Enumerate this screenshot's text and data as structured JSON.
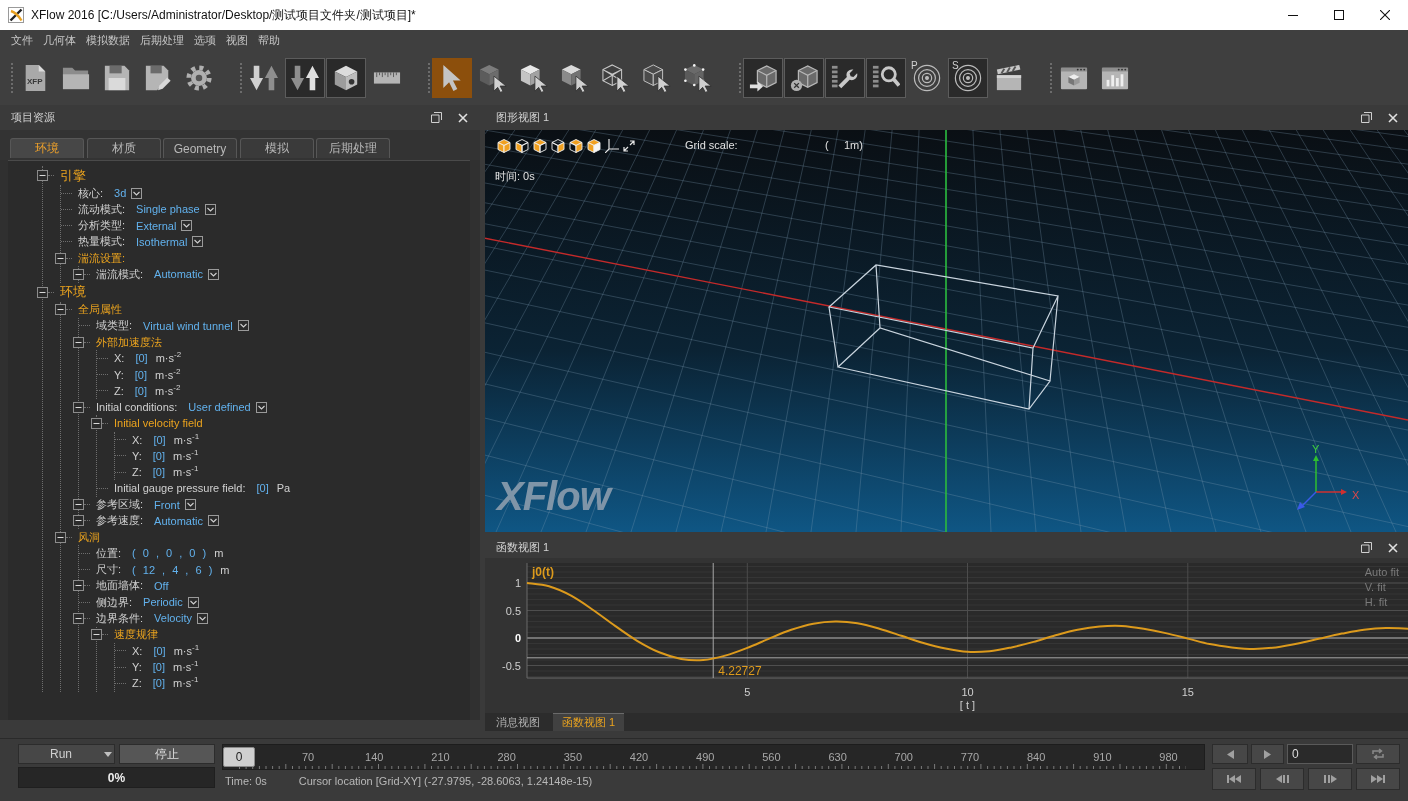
{
  "window": {
    "title": "XFlow 2016 [C:/Users/Administrator/Desktop/测试项目文件夹/测试项目]*"
  },
  "menu": [
    "文件",
    "几何体",
    "模拟数据",
    "后期处理",
    "选项",
    "视图",
    "帮助"
  ],
  "toolbar": {
    "groups": [
      [
        {
          "label": "XFP",
          "selected": false,
          "toggled": false
        },
        {
          "selected": false,
          "toggled": false
        },
        {
          "selected": false,
          "toggled": false
        },
        {
          "selected": false,
          "toggled": false
        },
        {
          "selected": false,
          "toggled": false
        }
      ],
      [
        {
          "selected": false,
          "toggled": false
        },
        {
          "selected": false,
          "toggled": true
        },
        {
          "selected": false,
          "toggled": true
        },
        {
          "selected": false,
          "toggled": false
        }
      ],
      [
        {
          "selected": true,
          "toggled": false
        },
        {
          "selected": false,
          "toggled": false
        },
        {
          "selected": false,
          "toggled": false
        },
        {
          "selected": false,
          "toggled": false
        },
        {
          "selected": false,
          "toggled": false
        },
        {
          "selected": false,
          "toggled": false
        },
        {
          "selected": false,
          "toggled": false
        }
      ],
      [
        {
          "selected": false,
          "toggled": true
        },
        {
          "selected": false,
          "toggled": true
        },
        {
          "selected": false,
          "toggled": true
        },
        {
          "selected": false,
          "toggled": true
        },
        {
          "label": "P",
          "selected": false,
          "toggled": false
        },
        {
          "label": "S",
          "selected": false,
          "toggled": true
        },
        {
          "selected": false,
          "toggled": false
        }
      ],
      [
        {
          "selected": false,
          "toggled": false
        },
        {
          "selected": false,
          "toggled": false
        }
      ]
    ]
  },
  "left_panel": {
    "title": "项目资源",
    "tabs": [
      {
        "label": "环境",
        "selected": true
      },
      {
        "label": "材质",
        "selected": false
      },
      {
        "label": "Geometry",
        "selected": false
      },
      {
        "label": "模拟",
        "selected": false
      },
      {
        "label": "后期处理",
        "selected": false
      }
    ],
    "tree": [
      {
        "kind": "group",
        "label": "引擎",
        "expanded": true,
        "children": [
          {
            "kind": "dropdown",
            "label": "核心:",
            "value": "3d"
          },
          {
            "kind": "dropdown",
            "label": "流动模式:",
            "value": "Single phase"
          },
          {
            "kind": "dropdown",
            "label": "分析类型:",
            "value": "External"
          },
          {
            "kind": "dropdown",
            "label": "热量模式:",
            "value": "Isothermal"
          },
          {
            "kind": "group",
            "label": "湍流设置:",
            "expanded": true,
            "children": [
              {
                "kind": "dropdown",
                "label": "湍流模式:",
                "value": "Automatic",
                "expanded": true
              }
            ]
          }
        ]
      },
      {
        "kind": "group",
        "label": "环境",
        "expanded": true,
        "children": [
          {
            "kind": "group",
            "label": "全局属性",
            "expanded": true,
            "children": [
              {
                "kind": "dropdown",
                "label": "域类型:",
                "value": "Virtual wind tunnel"
              },
              {
                "kind": "group",
                "label": "外部加速度法",
                "expanded": true,
                "children": [
                  {
                    "kind": "quantity",
                    "label": "X:",
                    "value": "[0]",
                    "unit": "m·s$^{-2}$"
                  },
                  {
                    "kind": "quantity",
                    "label": "Y:",
                    "value": "[0]",
                    "unit": "m·s$^{-2}$"
                  },
                  {
                    "kind": "quantity",
                    "label": "Z:",
                    "value": "[0]",
                    "unit": "m·s$^{-2}$"
                  }
                ]
              },
              {
                "kind": "dropdown",
                "label": "Initial conditions:",
                "value": "User defined",
                "expanded": true,
                "children": [
                  {
                    "kind": "group",
                    "label": "Initial velocity field",
                    "expanded": true,
                    "children": [
                      {
                        "kind": "quantity",
                        "label": "X:",
                        "value": "[0]",
                        "unit": "m·s$^{-1}$"
                      },
                      {
                        "kind": "quantity",
                        "label": "Y:",
                        "value": "[0]",
                        "unit": "m·s$^{-1}$"
                      },
                      {
                        "kind": "quantity",
                        "label": "Z:",
                        "value": "[0]",
                        "unit": "m·s$^{-1}$"
                      }
                    ]
                  },
                  {
                    "kind": "quantity",
                    "label": "Initial gauge pressure field:",
                    "value": "[0]",
                    "unit": "Pa"
                  }
                ]
              },
              {
                "kind": "dropdown",
                "label": "参考区域:",
                "value": "Front",
                "expanded": true
              },
              {
                "kind": "dropdown",
                "label": "参考速度:",
                "value": "Automatic",
                "expanded": true
              }
            ]
          },
          {
            "kind": "group",
            "label": "风洞",
            "expanded": true,
            "children": [
              {
                "kind": "quantity",
                "label": "位置:",
                "value": "( 0 , 0 , 0 )",
                "unit": "m"
              },
              {
                "kind": "quantity",
                "label": "尺寸:",
                "value": "( 12 , 4 , 6 )",
                "unit": "m"
              },
              {
                "kind": "text",
                "label": "地面墙体:",
                "value": "Off",
                "expanded": true
              },
              {
                "kind": "dropdown",
                "label": "侧边界:",
                "value": "Periodic"
              },
              {
                "kind": "dropdown",
                "label": "边界条件:",
                "value": "Velocity",
                "expanded": true,
                "children": [
                  {
                    "kind": "group",
                    "label": "速度规律",
                    "expanded": true,
                    "children": [
                      {
                        "kind": "quantity",
                        "label": "X:",
                        "value": "[0]",
                        "unit": "m·s$^{-1}$"
                      },
                      {
                        "kind": "quantity",
                        "label": "Y:",
                        "value": "[0]",
                        "unit": "m·s$^{-1}$"
                      },
                      {
                        "kind": "quantity",
                        "label": "Z:",
                        "value": "[0]",
                        "unit": "m·s$^{-1}$"
                      }
                    ]
                  }
                ]
              }
            ]
          }
        ]
      }
    ]
  },
  "viewport": {
    "title": "图形视图 1",
    "grid_scale_label": "Grid scale:",
    "grid_scale_value": "(     1m)",
    "time": "时间: 0s",
    "logo": "XFlow",
    "axis_labels": [
      "Y",
      "X"
    ]
  },
  "function_view": {
    "title": "函数视图 1",
    "fit_buttons": [
      "Auto fit",
      "V. fit",
      "H. fit"
    ],
    "chart_data": {
      "type": "line",
      "xlabel": "[ t ]",
      "xlim": [
        0,
        20
      ],
      "ylim": [
        -0.727,
        1.364
      ],
      "xticks": [
        5,
        10,
        15
      ],
      "yticks": [
        -0.5,
        0,
        0.5,
        1
      ],
      "grid": true,
      "x": [
        0,
        0.5,
        1,
        1.5,
        2,
        2.5,
        3,
        3.5,
        4,
        4.5,
        5,
        5.5,
        6,
        6.5,
        7,
        7.5,
        8,
        8.5,
        9,
        9.5,
        10,
        10.5,
        11,
        11.5,
        12,
        12.5,
        13,
        13.5,
        14,
        14.5,
        15,
        15.5,
        16,
        16.5,
        17,
        17.5,
        18,
        18.5,
        19,
        19.5,
        20
      ],
      "series": [
        {
          "name": "j0(t)",
          "color": "#dc9a1c",
          "values": [
            1,
            0.94,
            0.77,
            0.51,
            0.22,
            -0.05,
            -0.26,
            -0.38,
            -0.4,
            -0.32,
            -0.18,
            -0.01,
            0.15,
            0.26,
            0.3,
            0.27,
            0.17,
            0.04,
            -0.09,
            -0.19,
            -0.25,
            -0.24,
            -0.17,
            -0.07,
            0.05,
            0.15,
            0.21,
            0.22,
            0.17,
            0.09,
            -0.01,
            -0.11,
            -0.17,
            -0.2,
            -0.17,
            -0.1,
            -0.01,
            0.08,
            0.15,
            0.18,
            0.17
          ]
        }
      ],
      "ref_lines": [
        {
          "axis": "x",
          "value": 4.22727,
          "label": "4.22727"
        },
        {
          "axis": "y",
          "value": -0.36
        }
      ]
    },
    "tabs": [
      {
        "label": "消息视图",
        "selected": false
      },
      {
        "label": "函数视图 1",
        "selected": true
      }
    ]
  },
  "bottom_bar": {
    "run_button": "Run",
    "stop_button": "停止",
    "progress": {
      "level": 0,
      "label": "0%"
    },
    "timeline": {
      "level": 0,
      "thumb_label": "0",
      "ticks": [
        "70",
        "140",
        "210",
        "280",
        "350",
        "420",
        "490",
        "560",
        "630",
        "700",
        "770",
        "840",
        "910",
        "980"
      ],
      "time": "Time: 0s",
      "cursor_location": "Cursor location [Grid-XY] (-27.9795, -28.6063, 1.24148e-15)"
    },
    "frame_field": {
      "value": "0"
    }
  }
}
